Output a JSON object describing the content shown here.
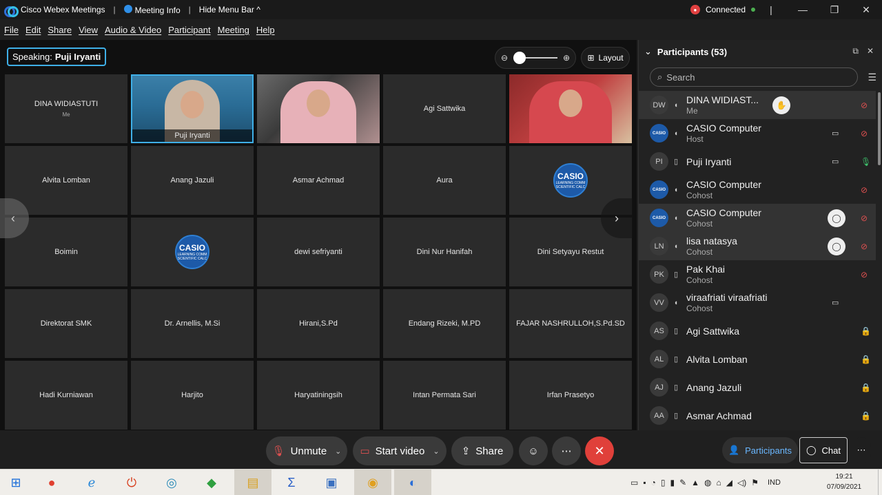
{
  "titlebar": {
    "app_name": "Cisco Webex Meetings",
    "meeting_info": "Meeting Info",
    "hide_menu": "Hide Menu Bar",
    "connection_status": "Connected"
  },
  "menu": [
    "File",
    "Edit",
    "Share",
    "View",
    "Audio & Video",
    "Participant",
    "Meeting",
    "Help"
  ],
  "speaking": {
    "label": "Speaking:",
    "name": "Puji Iryanti"
  },
  "layout_button": "Layout",
  "tiles": [
    {
      "name": "DINA WIDIASTUTI",
      "sub": "Me",
      "type": "name"
    },
    {
      "name": "Puji Iryanti",
      "type": "video1"
    },
    {
      "name": "",
      "type": "video2"
    },
    {
      "name": "Agi Sattwika",
      "type": "name"
    },
    {
      "name": "",
      "type": "video3"
    },
    {
      "name": "Alvita Lomban",
      "type": "name"
    },
    {
      "name": "Anang Jazuli",
      "type": "name"
    },
    {
      "name": "Asmar Achmad",
      "type": "name"
    },
    {
      "name": "Aura",
      "type": "name"
    },
    {
      "name": "",
      "type": "casio"
    },
    {
      "name": "Boimin",
      "type": "name"
    },
    {
      "name": "",
      "type": "casio"
    },
    {
      "name": "dewi sefriyanti",
      "type": "name"
    },
    {
      "name": "Dini Nur Hanifah",
      "type": "name"
    },
    {
      "name": "Dini Setyayu Restut",
      "type": "name"
    },
    {
      "name": "Direktorat SMK",
      "type": "name"
    },
    {
      "name": "Dr. Arnellis, M.Si",
      "type": "name"
    },
    {
      "name": "Hirani,S.Pd",
      "type": "name"
    },
    {
      "name": "Endang Rizeki, M.PD",
      "type": "name"
    },
    {
      "name": "FAJAR NASHRULLOH,S.Pd.SD",
      "type": "name"
    },
    {
      "name": "Hadi Kurniawan",
      "type": "name"
    },
    {
      "name": "Harjito",
      "type": "name"
    },
    {
      "name": "Haryatiningsih",
      "type": "name"
    },
    {
      "name": "Intan Permata Sari",
      "type": "name"
    },
    {
      "name": "Irfan Prasetyo",
      "type": "name"
    }
  ],
  "casio_logo": "CASIO",
  "casio_logo_sub": "LEARNING COMM SCIENTIFIC CALC",
  "panel": {
    "title": "Participants (53)",
    "search_placeholder": "Search",
    "participants": [
      {
        "initials": "DW",
        "name": "DINA WIDIAST...",
        "role": "Me",
        "video": false,
        "mic": "muted",
        "hand": true,
        "chat": false,
        "highlight": true
      },
      {
        "initials": "",
        "name": "CASIO Computer",
        "role": "Host",
        "video": true,
        "mic": "muted",
        "avatar": "casio"
      },
      {
        "initials": "PI",
        "name": "Puji Iryanti",
        "role": "",
        "video": true,
        "mic": "on"
      },
      {
        "initials": "",
        "name": "CASIO Computer",
        "role": "Cohost",
        "video": false,
        "mic": "muted",
        "avatar": "casio"
      },
      {
        "initials": "",
        "name": "CASIO Computer",
        "role": "Cohost",
        "video": false,
        "mic": "muted",
        "avatar": "casio",
        "chat": true,
        "highlight": true
      },
      {
        "initials": "LN",
        "name": "lisa natasya",
        "role": "Cohost",
        "video": false,
        "mic": "muted",
        "chat": true,
        "highlight": true
      },
      {
        "initials": "PK",
        "name": "Pak Khai",
        "role": "Cohost",
        "video": false,
        "mic": "muted"
      },
      {
        "initials": "VV",
        "name": "viraafriati viraafriati",
        "role": "Cohost",
        "video": true,
        "mic": "none"
      },
      {
        "initials": "AS",
        "name": "Agi Sattwika",
        "role": "",
        "video": false,
        "mic": "locked"
      },
      {
        "initials": "AL",
        "name": "Alvita Lomban",
        "role": "",
        "video": false,
        "mic": "locked"
      },
      {
        "initials": "AJ",
        "name": "Anang Jazuli",
        "role": "",
        "video": false,
        "mic": "locked"
      },
      {
        "initials": "AA",
        "name": "Asmar Achmad",
        "role": "",
        "video": false,
        "mic": "locked"
      }
    ]
  },
  "controls": {
    "unmute": "Unmute",
    "start_video": "Start video",
    "share": "Share",
    "participants": "Participants",
    "chat": "Chat"
  },
  "taskbar": {
    "language": "IND",
    "time": "19:21",
    "date": "07/09/2021"
  }
}
